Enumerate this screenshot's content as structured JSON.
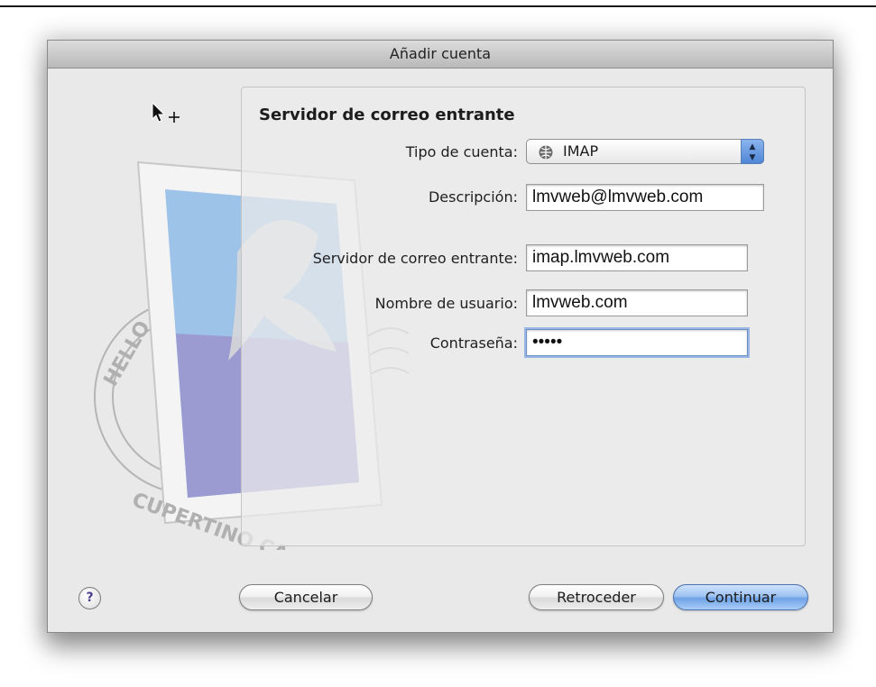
{
  "window": {
    "title": "Añadir cuenta"
  },
  "section": {
    "heading": "Servidor de correo entrante"
  },
  "form": {
    "account_type": {
      "label": "Tipo de cuenta:",
      "value": "IMAP",
      "icon": "globe-icon"
    },
    "description": {
      "label": "Descripción:",
      "value": "lmvweb@lmvweb.com"
    },
    "incoming_server": {
      "label": "Servidor de correo entrante:",
      "value": "imap.lmvweb.com"
    },
    "username": {
      "label": "Nombre de usuario:",
      "value": "lmvweb.com"
    },
    "password": {
      "label": "Contraseña:",
      "value": "•••••"
    }
  },
  "buttons": {
    "help": "?",
    "cancel": "Cancelar",
    "back": "Retroceder",
    "continue": "Continuar"
  },
  "stamp_text": {
    "top": "HELLO",
    "bottom": "CUPERTINO CA"
  },
  "colors": {
    "focus_ring": "#9ab6e4",
    "primary_button": "#6fa2e6",
    "stamp_sky": "#9ec3e8",
    "stamp_sea": "#9b9bd2"
  }
}
